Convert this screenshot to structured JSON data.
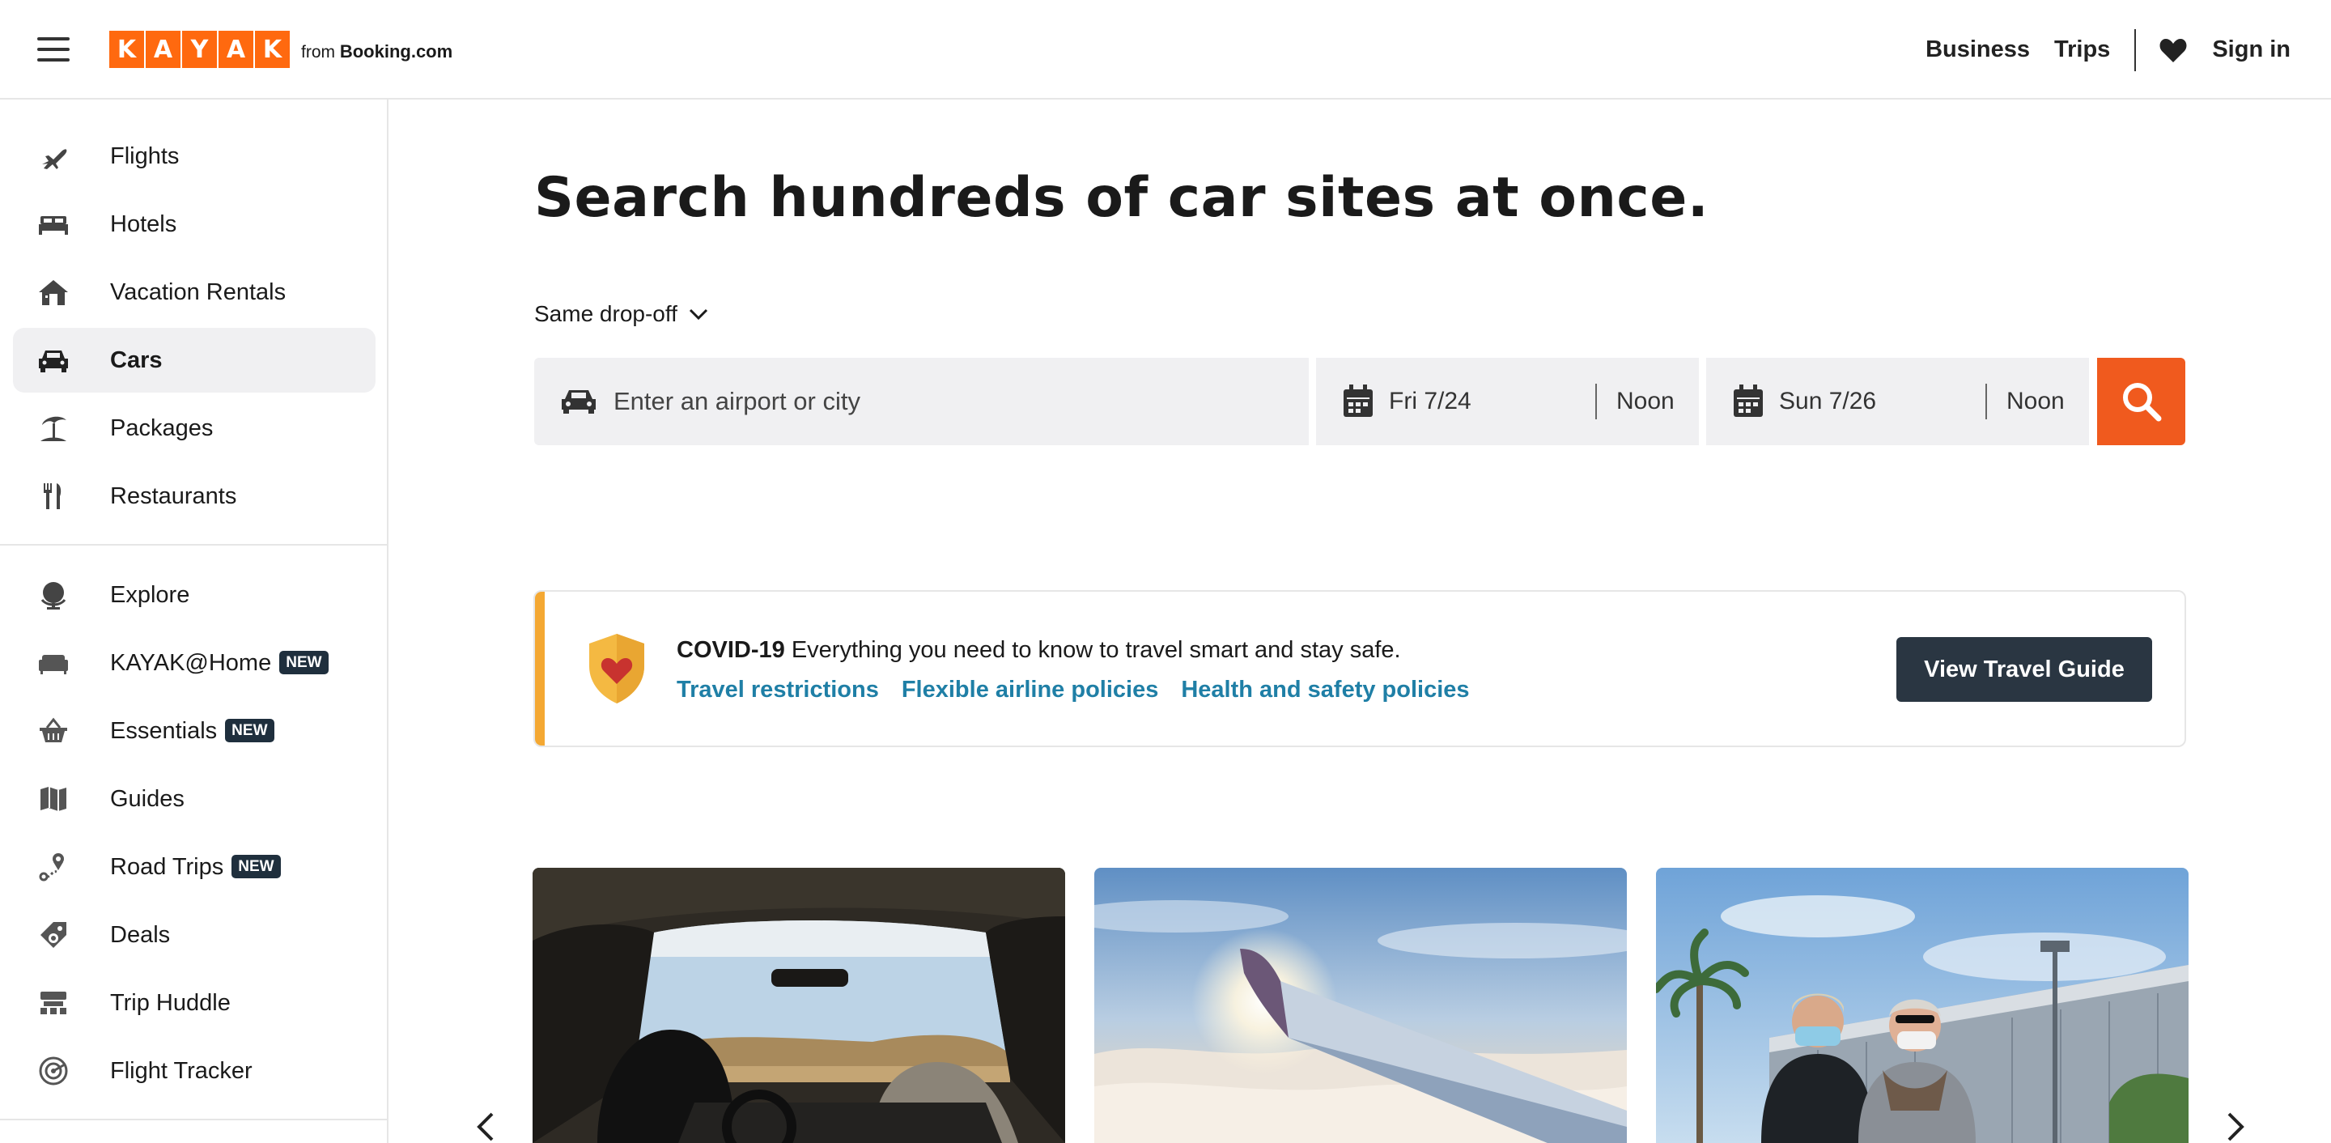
{
  "header": {
    "logo_letters": [
      "K",
      "A",
      "Y",
      "A",
      "K"
    ],
    "from_text": "from",
    "from_brand": "Booking.com",
    "nav": [
      {
        "label": "Business"
      },
      {
        "label": "Trips"
      }
    ],
    "sign_in": "Sign in",
    "accent_color": "#ff690f"
  },
  "sidebar": {
    "items": [
      {
        "label": "Flights",
        "icon": "plane-icon"
      },
      {
        "label": "Hotels",
        "icon": "bed-icon"
      },
      {
        "label": "Vacation Rentals",
        "icon": "house-icon"
      },
      {
        "label": "Cars",
        "icon": "car-icon",
        "active": true
      },
      {
        "label": "Packages",
        "icon": "beach-umbrella-icon"
      },
      {
        "label": "Restaurants",
        "icon": "utensils-icon"
      },
      {
        "label": "Explore",
        "icon": "globe-icon"
      },
      {
        "label": "KAYAK@Home",
        "icon": "sofa-icon",
        "badge": "NEW"
      },
      {
        "label": "Essentials",
        "icon": "basket-icon",
        "badge": "NEW"
      },
      {
        "label": "Guides",
        "icon": "map-icon"
      },
      {
        "label": "Road Trips",
        "icon": "route-pin-icon",
        "badge": "NEW"
      },
      {
        "label": "Deals",
        "icon": "tag-icon"
      },
      {
        "label": "Trip Huddle",
        "icon": "huddle-icon"
      },
      {
        "label": "Flight Tracker",
        "icon": "radar-icon"
      }
    ]
  },
  "main": {
    "headline": "Search hundreds of car sites at once.",
    "dropoff_label": "Same drop-off",
    "location_placeholder": "Enter an airport or city",
    "pickup": {
      "date": "Fri 7/24",
      "time": "Noon"
    },
    "dropoff": {
      "date": "Sun 7/26",
      "time": "Noon"
    },
    "search_color": "#f05a1e"
  },
  "covid": {
    "title": "COVID-19",
    "text": "Everything you need to know to travel smart and stay safe.",
    "links": [
      "Travel restrictions",
      "Flexible airline policies",
      "Health and safety policies"
    ],
    "button": "View Travel Guide"
  },
  "cards": [
    {
      "image": "car-interior-desert-photo"
    },
    {
      "image": "airplane-wing-clouds-photo"
    },
    {
      "image": "travelers-with-masks-photo"
    }
  ]
}
